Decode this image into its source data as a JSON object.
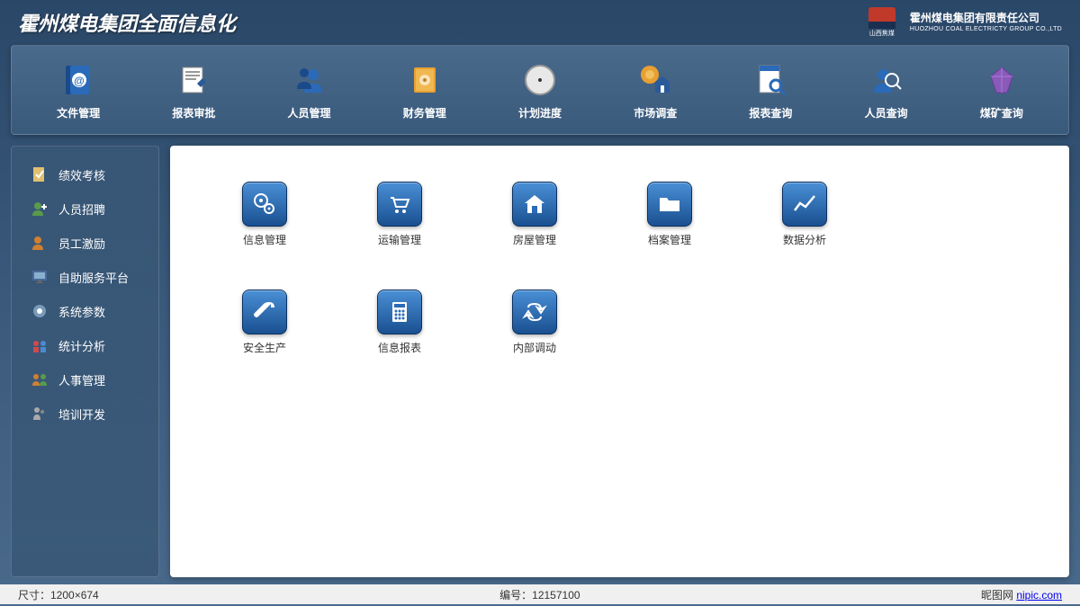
{
  "header": {
    "title": "霍州煤电集团全面信息化",
    "company_cn": "霍州煤电集团有限责任公司",
    "company_en": "HUOZHOU COAL ELECTRICTY GROUP CO.,LTD",
    "sublogo": "山西焦煤"
  },
  "topnav": {
    "items": [
      {
        "label": "文件管理"
      },
      {
        "label": "报表审批"
      },
      {
        "label": "人员管理"
      },
      {
        "label": "财务管理"
      },
      {
        "label": "计划进度"
      },
      {
        "label": "市场调查"
      },
      {
        "label": "报表查询"
      },
      {
        "label": "人员查询"
      },
      {
        "label": "煤矿查询"
      }
    ]
  },
  "sidebar": {
    "items": [
      {
        "label": "绩效考核"
      },
      {
        "label": "人员招聘"
      },
      {
        "label": "员工激励"
      },
      {
        "label": "自助服务平台"
      },
      {
        "label": "系统参数"
      },
      {
        "label": "统计分析"
      },
      {
        "label": "人事管理"
      },
      {
        "label": "培训开发"
      }
    ]
  },
  "tiles": {
    "items": [
      {
        "label": "信息管理"
      },
      {
        "label": "运输管理"
      },
      {
        "label": "房屋管理"
      },
      {
        "label": "档案管理"
      },
      {
        "label": "数据分析"
      },
      {
        "label": "安全生产"
      },
      {
        "label": "信息报表"
      },
      {
        "label": "内部调动"
      }
    ]
  },
  "footer": {
    "dimensions": "尺寸：1200×674",
    "id_label": "编号：",
    "id_value": "12157100",
    "site": "昵图网",
    "url": "nipic.com"
  }
}
